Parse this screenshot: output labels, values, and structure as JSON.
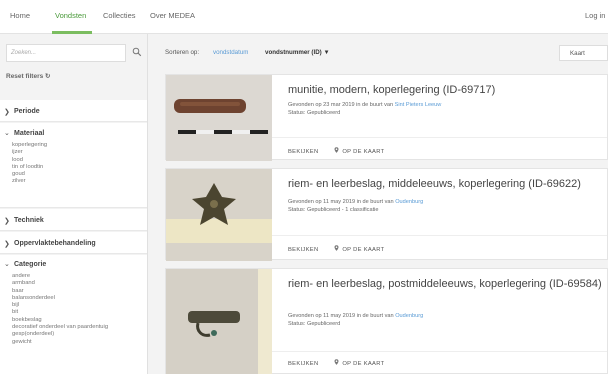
{
  "topnav": {
    "items": [
      {
        "label": "Home"
      },
      {
        "label": "Vondsten"
      },
      {
        "label": "Collecties"
      },
      {
        "label": "Over MEDEA"
      }
    ],
    "login": "Log in",
    "accent": "#7bbd60"
  },
  "sidebar": {
    "search_placeholder": "Zoeken...",
    "reset_label": "Reset filters ↻",
    "facets": {
      "periode": "Periode",
      "materiaal": "Materiaal",
      "materiaal_items": [
        "koperlegering",
        "ijzer",
        "lood",
        "tin of loodtin",
        "goud",
        "zilver"
      ],
      "techniek": "Techniek",
      "oppervlakte": "Oppervlaktebehandeling",
      "categorie": "Categorie",
      "categorie_items": [
        "andere",
        "armband",
        "baar",
        "balansonderdeel",
        "bijl",
        "bit",
        "boekbeslag",
        "decoratief onderdeel van paardentuig",
        "gesp(onderdeel)",
        "gewicht"
      ]
    }
  },
  "sortbar": {
    "label": "Sorteren op:",
    "option_date": "vondstdatum",
    "option_number": "vondstnummer (ID) ▼",
    "map_button": "Kaart"
  },
  "results": [
    {
      "title": "munitie, modern, koperlegering (ID-69717)",
      "found_prefix": "Gevonden op 23 mar 2019 in de buurt van ",
      "place": "Sint Pieters Leeuw",
      "status": "Status: Gepubliceerd",
      "view": "BEKIJKEN",
      "map": "OP DE KAART"
    },
    {
      "title": "riem- en leerbeslag, middeleeuws, koperlegering (ID-69622)",
      "found_prefix": "Gevonden op 11 may 2019 in de buurt van ",
      "place": "Oudenburg",
      "status": "Status: Gepubliceerd - 1 classificatie",
      "view": "BEKIJKEN",
      "map": "OP DE KAART"
    },
    {
      "title": "riem- en leerbeslag, postmiddeleeuws, koperlegering (ID-69584)",
      "found_prefix": "Gevonden op 11 may 2019 in de buurt van ",
      "place": "Oudenburg",
      "status": "Status: Gepubliceerd",
      "view": "BEKIJKEN",
      "map": "OP DE KAART"
    }
  ]
}
